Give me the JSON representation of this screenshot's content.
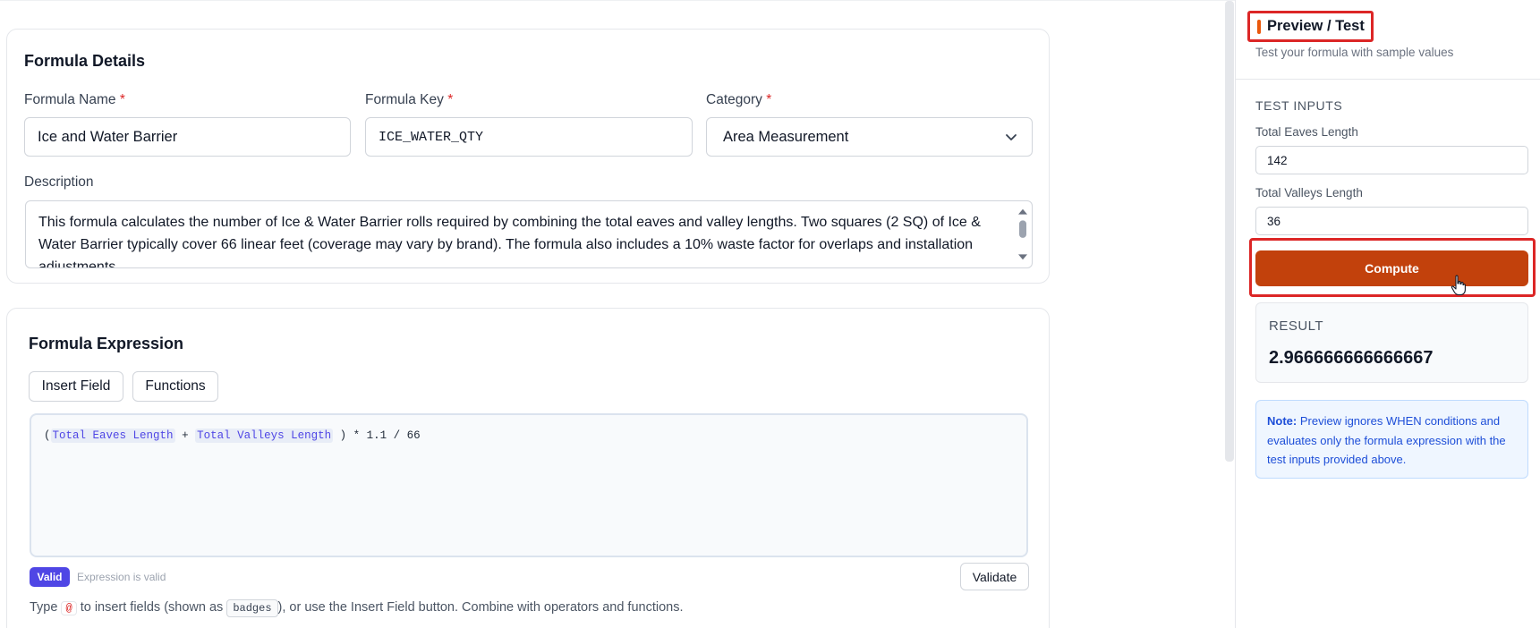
{
  "details": {
    "title": "Formula Details",
    "name_label": "Formula Name",
    "name_value": "Ice and Water Barrier",
    "key_label": "Formula Key",
    "key_value": "ICE_WATER_QTY",
    "category_label": "Category",
    "category_value": "Area Measurement",
    "required_mark": "*",
    "description_label": "Description",
    "description_value": "This formula calculates the number of Ice & Water Barrier rolls required by combining the total eaves and valley lengths. Two squares (2 SQ) of Ice & Water Barrier typically cover 66 linear feet (coverage may vary by brand). The formula also includes a 10% waste factor for overlaps and installation adjustments."
  },
  "expression": {
    "title": "Formula Expression",
    "insert_field_label": "Insert Field",
    "functions_label": "Functions",
    "open_paren": "(",
    "field1": "Total Eaves Length",
    "plus": "+",
    "field2": "Total Valleys Length",
    "tail": ") * 1.1 / 66",
    "valid_label": "Valid",
    "status_text": "Expression is valid",
    "validate_label": "Validate",
    "hint_prefix": "Type",
    "hint_at": "@",
    "hint_mid": "to insert fields (shown as",
    "hint_badge": "badges",
    "hint_suffix": "), or use the Insert Field button. Combine with operators and functions."
  },
  "preview": {
    "title": "Preview / Test",
    "subtitle": "Test your formula with sample values",
    "inputs_heading": "TEST INPUTS",
    "eaves_label": "Total Eaves Length",
    "eaves_value": "142",
    "valleys_label": "Total Valleys Length",
    "valleys_value": "36",
    "compute_label": "Compute",
    "result_label": "RESULT",
    "result_value": "2.966666666666667",
    "note_bold": "Note:",
    "note_text": "Preview ignores WHEN conditions and evaluates only the formula expression with the test inputs provided above."
  },
  "colors": {
    "accent": "#c2410c",
    "highlight": "#dc2626",
    "valid": "#4f46e5"
  },
  "icons": {
    "category_dropdown": "chevron-down-icon",
    "cursor": "hand-pointer-icon"
  }
}
